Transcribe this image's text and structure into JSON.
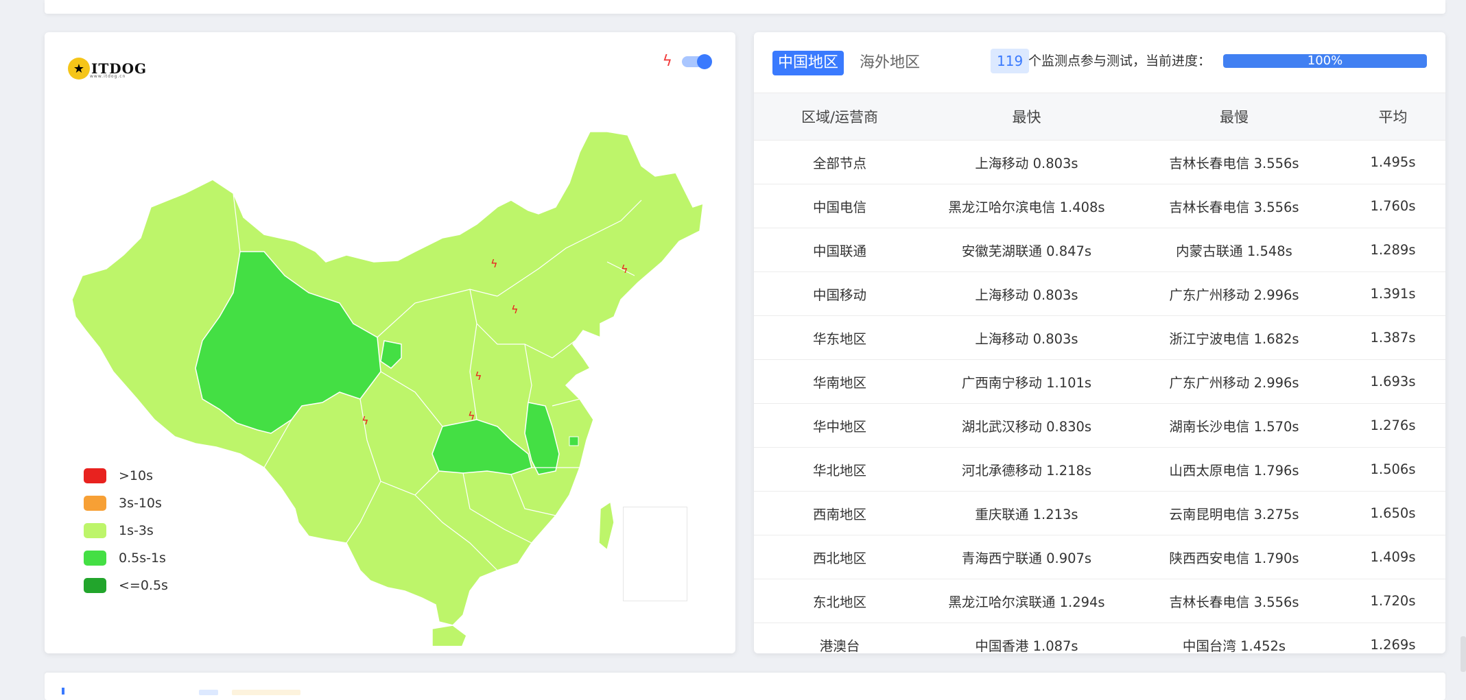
{
  "logo": {
    "text": "ITDOG",
    "sub": "www.itdog.cn"
  },
  "map": {
    "colors": {
      "gt10": "#e8221f",
      "s3to10": "#f7a035",
      "s1to3": "#bdf56a",
      "s05to1": "#44df44",
      "le05": "#22a52c"
    },
    "legend": [
      {
        "label": ">10s",
        "color": "#e8221f"
      },
      {
        "label": "3s-10s",
        "color": "#f7a035"
      },
      {
        "label": "1s-3s",
        "color": "#bdf56a"
      },
      {
        "label": "0.5s-1s",
        "color": "#44df44"
      },
      {
        "label": "<=0.5s",
        "color": "#22a52c"
      }
    ],
    "toggle_on": true
  },
  "tabs": {
    "china": "中国地区",
    "overseas": "海外地区"
  },
  "progress": {
    "count": "119",
    "label": "个监测点参与测试，当前进度：",
    "percent_text": "100%",
    "percent": 100
  },
  "table": {
    "headers": [
      "区域/运营商",
      "最快",
      "最慢",
      "平均"
    ],
    "rows": [
      [
        "全部节点",
        "上海移动 0.803s",
        "吉林长春电信 3.556s",
        "1.495s"
      ],
      [
        "中国电信",
        "黑龙江哈尔滨电信 1.408s",
        "吉林长春电信 3.556s",
        "1.760s"
      ],
      [
        "中国联通",
        "安徽芜湖联通 0.847s",
        "内蒙古联通 1.548s",
        "1.289s"
      ],
      [
        "中国移动",
        "上海移动 0.803s",
        "广东广州移动 2.996s",
        "1.391s"
      ],
      [
        "华东地区",
        "上海移动 0.803s",
        "浙江宁波电信 1.682s",
        "1.387s"
      ],
      [
        "华南地区",
        "广西南宁移动 1.101s",
        "广东广州移动 2.996s",
        "1.693s"
      ],
      [
        "华中地区",
        "湖北武汉移动 0.830s",
        "湖南长沙电信 1.570s",
        "1.276s"
      ],
      [
        "华北地区",
        "河北承德移动 1.218s",
        "山西太原电信 1.796s",
        "1.506s"
      ],
      [
        "西南地区",
        "重庆联通 1.213s",
        "云南昆明电信 3.275s",
        "1.650s"
      ],
      [
        "西北地区",
        "青海西宁联通 0.907s",
        "陕西西安电信 1.790s",
        "1.409s"
      ],
      [
        "东北地区",
        "黑龙江哈尔滨联通 1.294s",
        "吉林长春电信 3.556s",
        "1.720s"
      ],
      [
        "港澳台",
        "中国香港 1.087s",
        "中国台湾 1.452s",
        "1.269s"
      ]
    ]
  }
}
